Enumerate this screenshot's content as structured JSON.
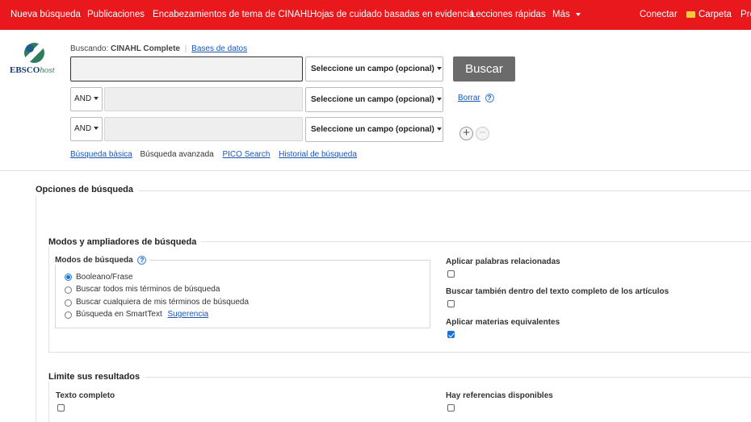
{
  "topnav": {
    "left": [
      "Nueva búsqueda",
      "Publicaciones",
      "Encabezamientos de tema de CINAHL",
      "Hojas de cuidado basadas en evidencia",
      "Lecciones rápidas",
      "Más"
    ],
    "right": [
      "Conectar",
      "Carpeta",
      "Pre"
    ]
  },
  "logo": {
    "brand": "EBSCO",
    "suffix": "host"
  },
  "search": {
    "searching_label": "Buscando:",
    "database": "CINAHL Complete",
    "databases_link": "Bases de datos",
    "field_select": "Seleccione un campo (opcional)",
    "bool_operator": "AND",
    "search_button": "Buscar",
    "clear_link": "Borrar",
    "help_glyph": "?",
    "add_glyph": "+",
    "remove_glyph": "−",
    "links": [
      "Búsqueda básica",
      "Búsqueda avanzada",
      "PICO Search",
      "Historial de búsqueda"
    ]
  },
  "options": {
    "title": "Opciones de búsqueda",
    "modes_section": "Modos y ampliadores de búsqueda",
    "modes_title": "Modos de búsqueda",
    "modes": [
      "Booleano/Frase",
      "Buscar todos mis términos de búsqueda",
      "Buscar cualquiera de mis términos de búsqueda",
      "Búsqueda en SmartText"
    ],
    "selected_mode_index": 0,
    "smarttext_hint": "Sugerencia",
    "expanders": [
      {
        "label": "Aplicar palabras relacionadas",
        "checked": false
      },
      {
        "label": "Buscar también dentro del texto completo de los artículos",
        "checked": false
      },
      {
        "label": "Aplicar materias equivalentes",
        "checked": true
      }
    ],
    "limits_section": "Limite sus resultados",
    "limits": [
      {
        "label": "Texto completo",
        "checked": false
      },
      {
        "label": "Hay referencias disponibles",
        "checked": false
      }
    ]
  }
}
